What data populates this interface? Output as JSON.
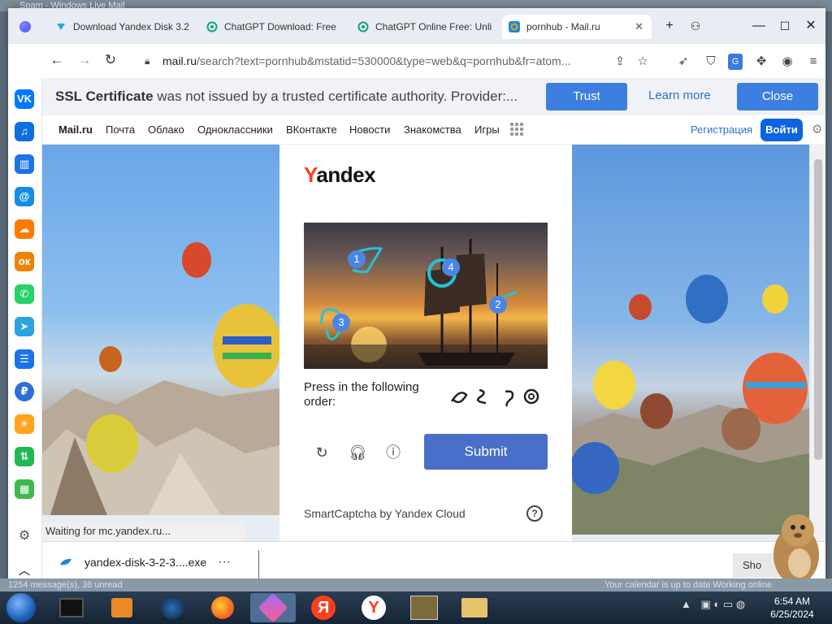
{
  "background_window": {
    "title": "Spam - Windows Live Mail",
    "footer_left": "1254 message(s), 38 unread",
    "footer_right": "Your calendar is up to date   Working online"
  },
  "tabs": [
    {
      "label": "Download Yandex Disk 3.2",
      "icon": "yandex-disk-icon"
    },
    {
      "label": "ChatGPT Download: Free",
      "icon": "chatgpt-icon"
    },
    {
      "label": "ChatGPT Online Free: Unli",
      "icon": "chatgpt-icon"
    },
    {
      "label": "pornhub - Mail.ru",
      "icon": "mailru-at-icon",
      "active": true
    }
  ],
  "address": {
    "host": "mail.ru",
    "rest": "/search?text=pornhub&mstatid=530000&type=web&q=pornhub&fr=atom..."
  },
  "ssl_banner": {
    "bold": "SSL Certificate",
    "text": " was not issued by a trusted certificate authority. Provider:...",
    "trust": "Trust",
    "learn_more": "Learn more",
    "close": "Close"
  },
  "mail_nav": {
    "brand": "Mail.ru",
    "links": [
      "Почта",
      "Облако",
      "Одноклассники",
      "ВКонтакте",
      "Новости",
      "Знакомства",
      "Игры"
    ],
    "register": "Регистрация",
    "login": "Войти"
  },
  "captcha": {
    "logo_first": "Y",
    "logo_rest": "andex",
    "marker_numbers": [
      "1",
      "2",
      "3",
      "4"
    ],
    "instruction": "Press in the following order:",
    "submit": "Submit",
    "footer": "SmartCaptcha by Yandex Cloud",
    "help": "?"
  },
  "status_text": "Waiting for mc.yandex.ru...",
  "download": {
    "filename": "yandex-disk-3-2-3....exe",
    "more": "···",
    "show": "Sho"
  },
  "clock": {
    "time": "6:54 AM",
    "date": "6/25/2024"
  },
  "colors": {
    "accent": "#3d7fe0",
    "submit": "#4a6fc9",
    "yandex_red": "#fc3f1d",
    "login": "#0d64de"
  }
}
